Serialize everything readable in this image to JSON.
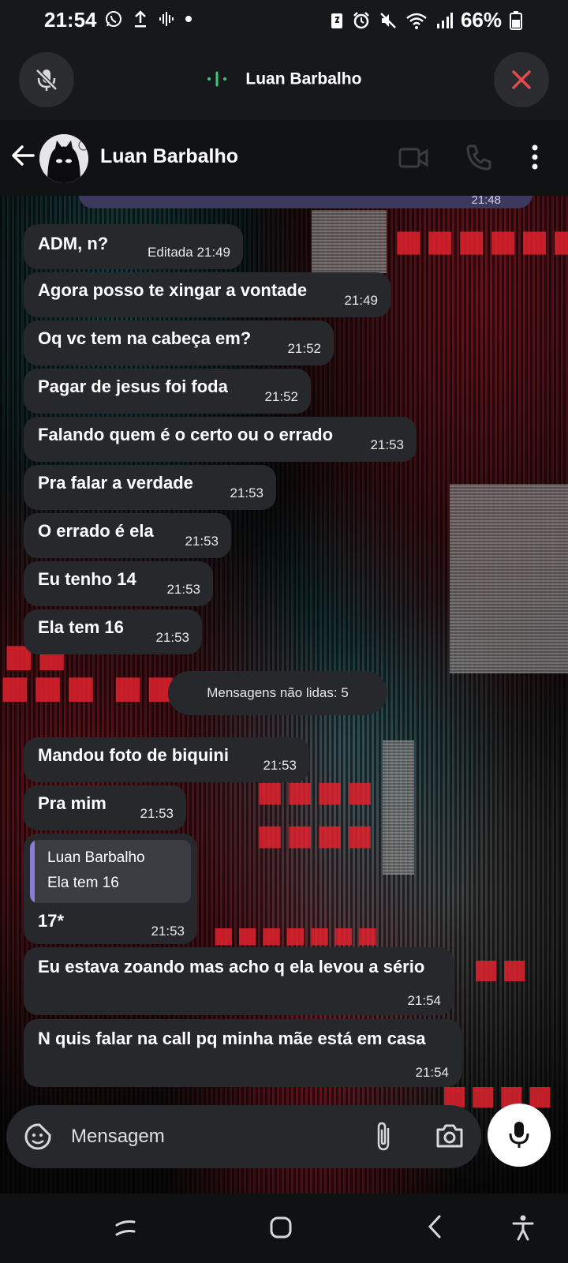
{
  "status_bar": {
    "time": "21:54",
    "battery": "66%"
  },
  "call_bar": {
    "contact": "Luan Barbalho"
  },
  "header": {
    "name": "Luan Barbalho"
  },
  "previous_message": {
    "time": "21:48"
  },
  "messages": [
    {
      "text": "ADM, n?",
      "edited": "Editada",
      "time": "21:49"
    },
    {
      "text": "Agora posso te xingar a vontade",
      "time": "21:49"
    },
    {
      "text": "Oq vc tem na cabeça em?",
      "time": "21:52"
    },
    {
      "text": "Pagar de jesus foi foda",
      "time": "21:52"
    },
    {
      "text": "Falando quem é o certo ou o errado",
      "time": "21:53"
    },
    {
      "text": "Pra falar a verdade",
      "time": "21:53"
    },
    {
      "text": "O errado é ela",
      "time": "21:53"
    },
    {
      "text": "Eu tenho 14",
      "time": "21:53"
    },
    {
      "text": "Ela tem 16",
      "time": "21:53"
    },
    {
      "text": "Mandou foto de biquini",
      "time": "21:53"
    },
    {
      "text": "Pra mim",
      "time": "21:53"
    },
    {
      "text": "17*",
      "time": "21:53",
      "quote_name": "Luan Barbalho",
      "quote_text": "Ela tem 16"
    },
    {
      "text": "Eu estava zoando mas acho q ela levou a sério",
      "time": "21:54"
    },
    {
      "text": "N quis falar na call pq minha mãe está em casa",
      "time": "21:54"
    }
  ],
  "unread_divider": "Mensagens não lidas: 5",
  "composer": {
    "placeholder": "Mensagem"
  },
  "colors": {
    "bubble": "#26282c",
    "end_call": "#e5484d",
    "quote_bar": "#8a7cd6",
    "own_bubble": "#3b3a5e"
  }
}
